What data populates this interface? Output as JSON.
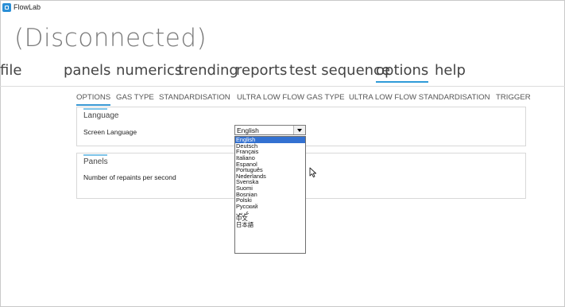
{
  "window": {
    "title": "FlowLab"
  },
  "header": {
    "status": "(Disconnected)"
  },
  "menu": [
    {
      "label": "file",
      "active": false
    },
    {
      "label": "panels",
      "active": false
    },
    {
      "label": "numerics",
      "active": false
    },
    {
      "label": "trending",
      "active": false
    },
    {
      "label": "reports",
      "active": false
    },
    {
      "label": "test sequence",
      "active": false
    },
    {
      "label": "options",
      "active": true
    },
    {
      "label": "help",
      "active": false
    }
  ],
  "tabs": [
    {
      "label": "OPTIONS",
      "active": true
    },
    {
      "label": "GAS TYPE",
      "active": false
    },
    {
      "label": "STANDARDISATION",
      "active": false
    },
    {
      "label": "ULTRA LOW FLOW GAS TYPE",
      "active": false
    },
    {
      "label": "ULTRA LOW FLOW STANDARDISATION",
      "active": false
    },
    {
      "label": "TRIGGER",
      "active": false
    }
  ],
  "language_section": {
    "title": "Language",
    "screen_language_label": "Screen Language",
    "selected_language": "English",
    "options": [
      "English",
      "Deutsch",
      "Français",
      "Italiano",
      "Espanol",
      "Português",
      "Nederlands",
      "Svenska",
      "Suomi",
      "Bosnian",
      "Polski",
      "Русский",
      "عربي",
      "中文",
      "日本語"
    ]
  },
  "panels_section": {
    "title": "Panels",
    "repaints_label": "Number of repaints per second"
  },
  "colors": {
    "accent": "#2f9bd8",
    "selection": "#3371d1",
    "status_text": "#7a7a7a"
  },
  "icons": {
    "app": "flowlab-app-icon",
    "cursor": "mouse-pointer-icon",
    "dropdown": "chevron-down-icon"
  }
}
